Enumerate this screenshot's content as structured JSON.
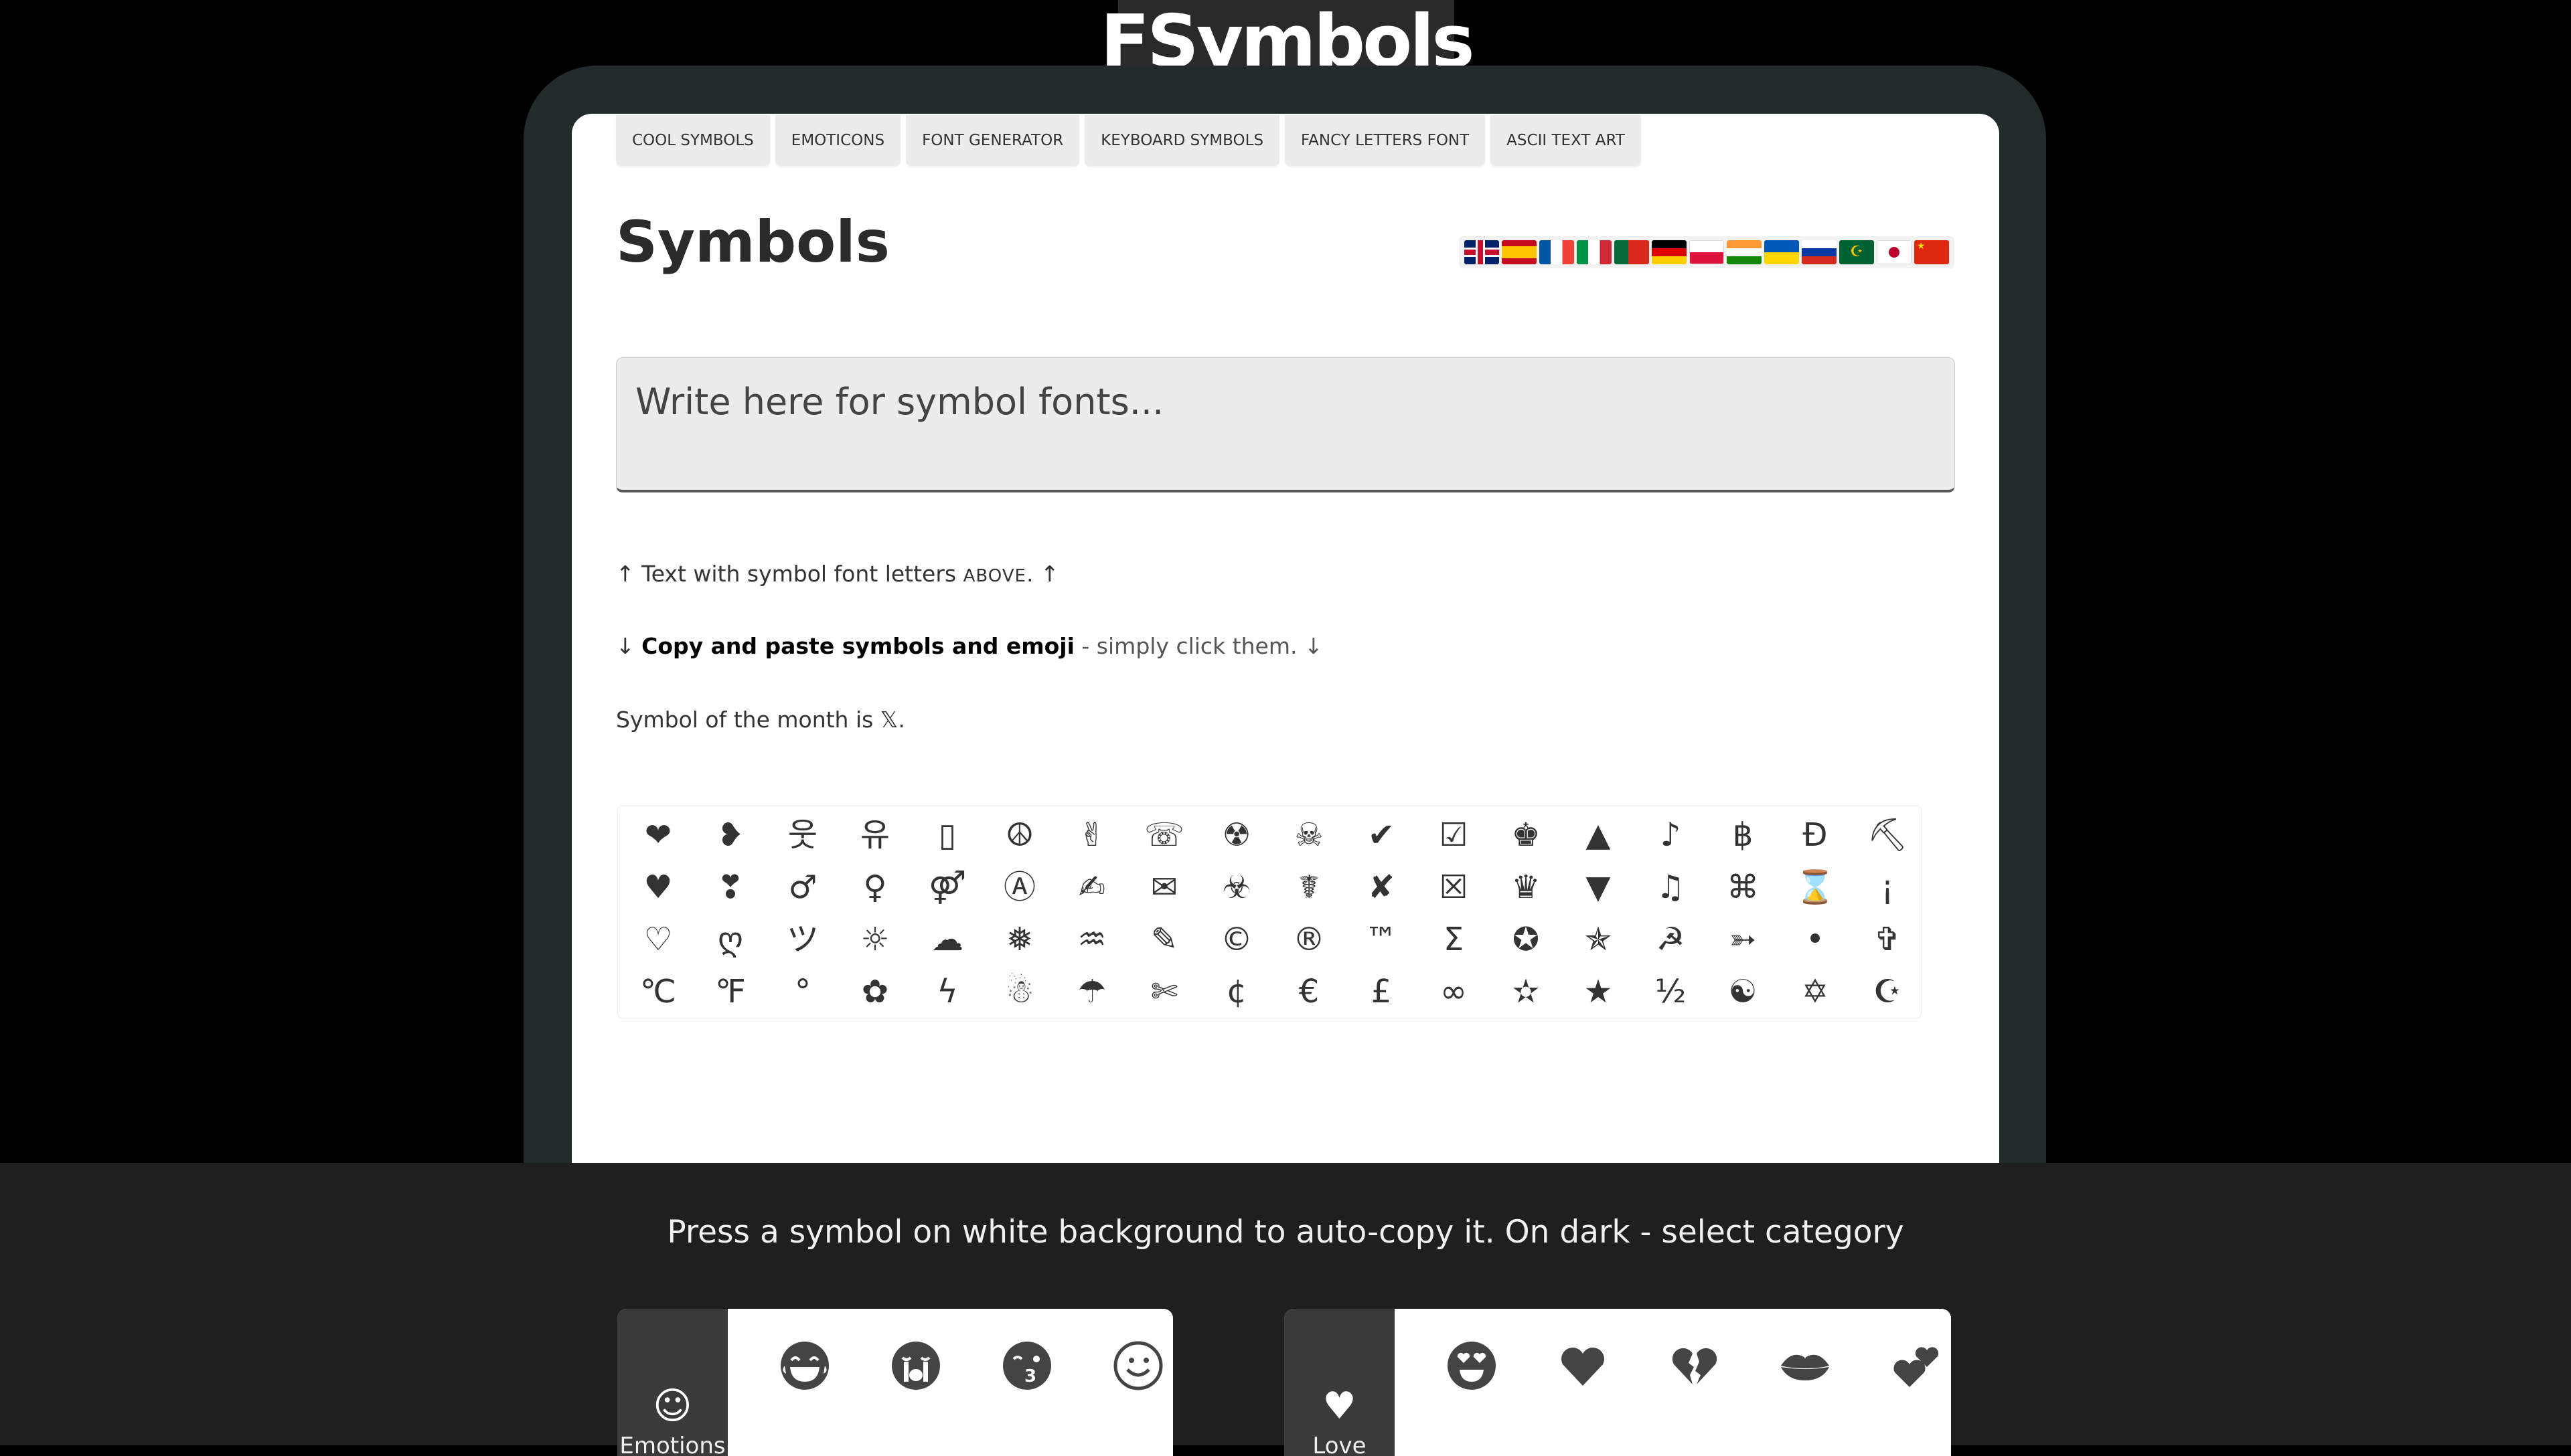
{
  "logo": {
    "text": "FSymbols"
  },
  "nav": {
    "tabs": [
      "COOL SYMBOLS",
      "EMOTICONS",
      "FONT GENERATOR",
      "KEYBOARD SYMBOLS",
      "FANCY LETTERS FONT",
      "ASCII TEXT ART"
    ]
  },
  "page": {
    "title": "Symbols"
  },
  "flags": [
    "english-flag",
    "spanish-flag",
    "french-flag",
    "italian-flag",
    "portuguese-flag",
    "german-flag",
    "polish-flag",
    "indian-flag",
    "ukrainian-flag",
    "russian-flag",
    "mauritanian-flag",
    "japanese-flag",
    "chinese-flag"
  ],
  "input": {
    "placeholder": "Write here for symbol fonts..."
  },
  "info": {
    "line1_prefix": "↑ Text with symbol font letters ",
    "line1_above": "ABOVE",
    "line1_suffix": ". ↑",
    "line2_prefix": "↓ ",
    "line2_bold": "Copy and paste symbols and emoji",
    "line2_suffix": " - simply click them. ↓",
    "line3": "Symbol of the month is 𝕏."
  },
  "symbols": [
    "❤",
    "❥",
    "웃",
    "유",
    "▯",
    "☮",
    "✌",
    "☏",
    "☢",
    "☠",
    "✔",
    "☑",
    "♚",
    "▲",
    "♪",
    "฿",
    "Ɖ",
    "⛏",
    "♥",
    "❣",
    "♂",
    "♀",
    "⚤",
    "Ⓐ",
    "✍",
    "✉",
    "☣",
    "☤",
    "✘",
    "☒",
    "♛",
    "▼",
    "♫",
    "⌘",
    "⌛",
    "¡",
    "♡",
    "ღ",
    "ツ",
    "☼",
    "☁",
    "❅",
    "♒",
    "✎",
    "©",
    "®",
    "™",
    "Σ",
    "✪",
    "✯",
    "☭",
    "➳",
    "•",
    "✞",
    "℃",
    "℉",
    "°",
    "✿",
    "ϟ",
    "☃",
    "☂",
    "✄",
    "¢",
    "€",
    "£",
    "∞",
    "✫",
    "★",
    "½",
    "☯",
    "✡",
    "☪"
  ],
  "bottom": {
    "message": "Press a symbol on white background to auto-copy it. On dark - select category",
    "panels": [
      {
        "icon": "☺",
        "label": "Emotions",
        "emojis": [
          "laughing-tears-face",
          "crying-loudly-face",
          "kissing-wink-face",
          "smiling-face"
        ]
      },
      {
        "icon": "♥",
        "label": "Love",
        "emojis": [
          "heart-eyes-face",
          "heart",
          "broken-heart",
          "kiss-lips",
          "two-hearts"
        ]
      }
    ]
  },
  "colors": {
    "background": "#000000",
    "frame": "#232a2c",
    "bottom_bar": "#1f1f1f",
    "tab_bg": "#ececec"
  }
}
